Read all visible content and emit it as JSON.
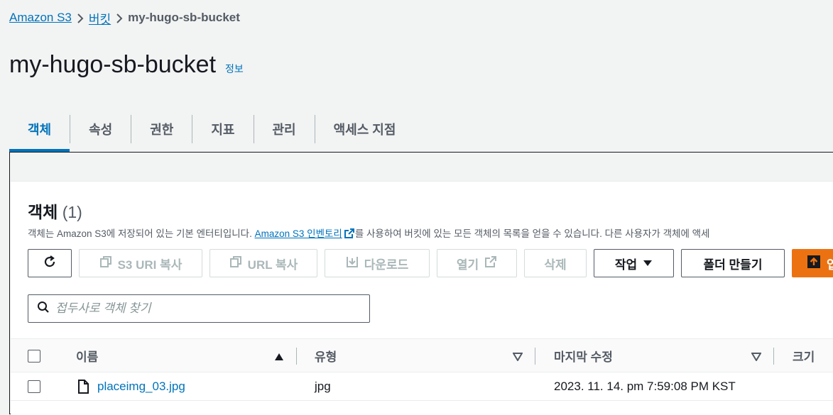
{
  "breadcrumb": {
    "root": "Amazon S3",
    "buckets": "버킷",
    "current": "my-hugo-sb-bucket"
  },
  "page": {
    "title": "my-hugo-sb-bucket",
    "info": "정보"
  },
  "tabs": [
    {
      "label": "객체",
      "active": true
    },
    {
      "label": "속성"
    },
    {
      "label": "권한"
    },
    {
      "label": "지표"
    },
    {
      "label": "관리"
    },
    {
      "label": "액세스 지점"
    }
  ],
  "objects": {
    "heading": "객체",
    "count": "(1)",
    "desc_before": "객체는 Amazon S3에 저장되어 있는 기본 엔터티입니다. ",
    "desc_link": "Amazon S3 인벤토리",
    "desc_after": "를 사용하여 버킷에 있는 모든 객체의 목록을 얻을 수 있습니다. 다른 사용자가 객체에 액세"
  },
  "toolbar": {
    "refresh_icon": "refresh-icon",
    "copy_s3_uri": "S3 URI 복사",
    "copy_url": "URL 복사",
    "download": "다운로드",
    "open": "열기",
    "delete": "삭제",
    "actions": "작업",
    "create_folder": "폴더 만들기",
    "upload": "업"
  },
  "search": {
    "placeholder": "접두사로 객체 찾기",
    "value": ""
  },
  "table": {
    "columns": [
      "이름",
      "유형",
      "마지막 수정",
      "크기"
    ],
    "rows": [
      {
        "name": "placeimg_03.jpg",
        "type": "jpg",
        "modified": "2023. 11. 14. pm 7:59:08 PM KST",
        "size": ""
      }
    ]
  },
  "colors": {
    "link": "#0073bb",
    "primary": "#ec7211",
    "text": "#16191f",
    "muted": "#545b64",
    "background": "#f2f3f3"
  }
}
